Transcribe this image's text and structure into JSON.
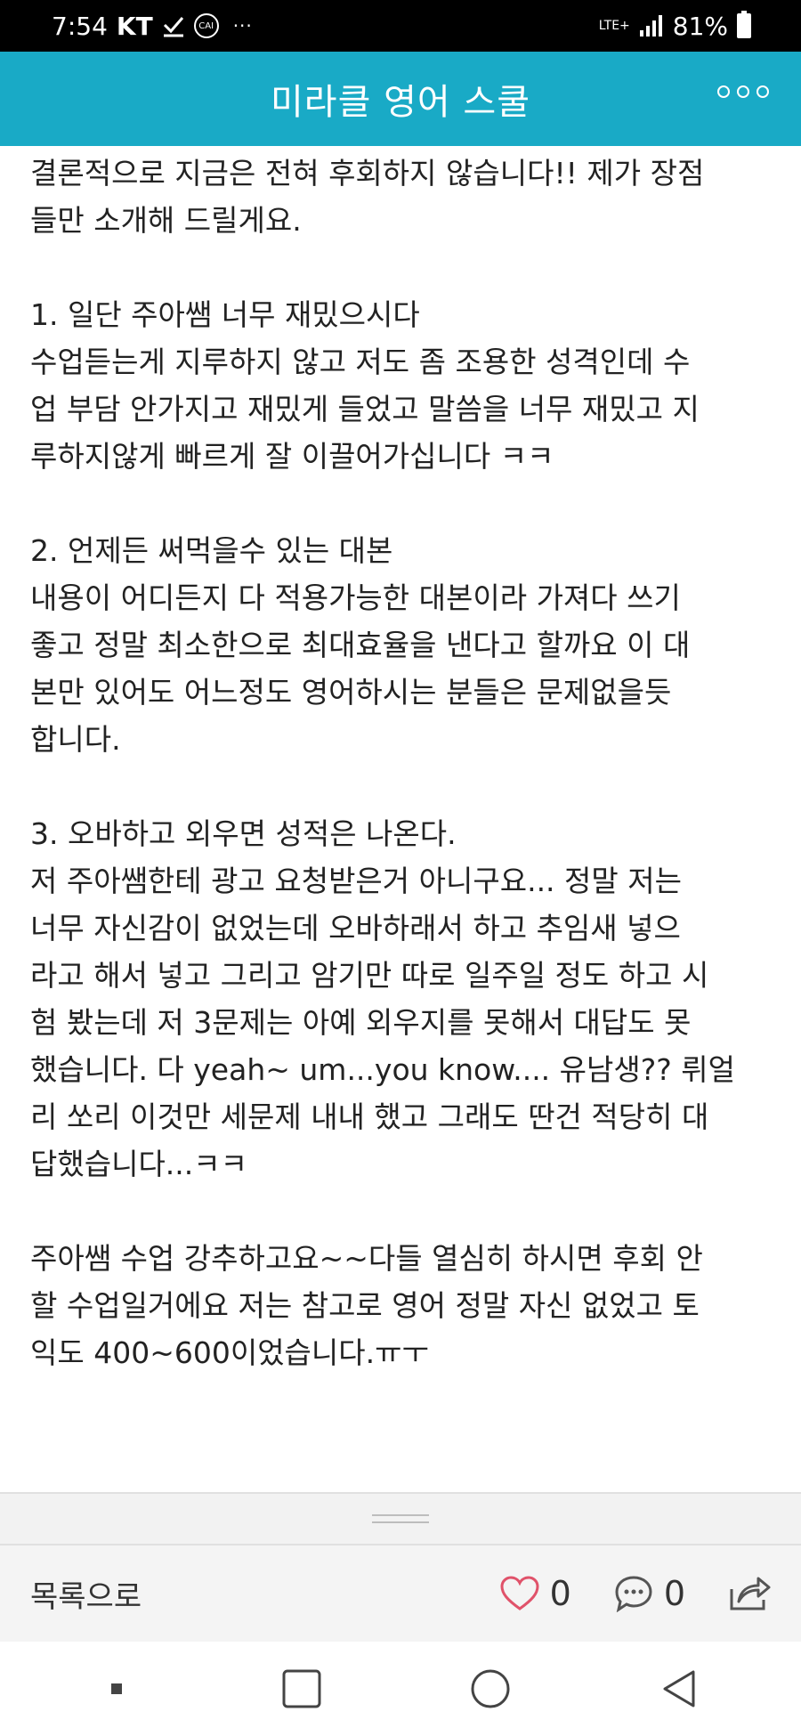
{
  "status_bar": {
    "time": "7:54",
    "carrier": "KT",
    "cai_label": "CAI",
    "more": "···",
    "network": "LTE+",
    "battery": "81%"
  },
  "app_bar": {
    "title": "미라클 영어 스쿨"
  },
  "post": {
    "paragraphs": [
      {
        "lines": [
          "결론적으로 지금은 전혀 후회하지 않습니다!! 제가 장점",
          "들만 소개해 드릴게요."
        ]
      },
      {
        "lines": [
          "1. 일단 주아쌤 너무 재밌으시다",
          "수업듣는게 지루하지 않고 저도 좀 조용한 성격인데 수",
          "업 부담 안가지고 재밌게 들었고 말씀을 너무 재밌고 지",
          "루하지않게 빠르게 잘 이끌어가십니다 ㅋㅋ"
        ]
      },
      {
        "lines": [
          "2. 언제든 써먹을수 있는 대본",
          "내용이 어디든지 다 적용가능한 대본이라 가져다 쓰기",
          "좋고 정말 최소한으로 최대효율을 낸다고 할까요 이 대",
          "본만 있어도 어느정도 영어하시는 분들은 문제없을듯",
          "합니다."
        ]
      },
      {
        "lines": [
          "3. 오바하고 외우면 성적은 나온다.",
          "저 주아쌤한테 광고 요청받은거 아니구요... 정말 저는",
          "너무 자신감이 없었는데 오바하래서 하고 추임새 넣으",
          "라고 해서 넣고 그리고 암기만 따로 일주일 정도 하고 시",
          "험 봤는데 저 3문제는 아예 외우지를 못해서 대답도 못",
          "했습니다. 다 yeah~ um...you know.... 유남생?? 뤼얼",
          "리 쏘리 이것만 세문제 내내 했고 그래도 딴건 적당히 대",
          "답했습니다...ㅋㅋ"
        ]
      },
      {
        "lines": [
          "주아쌤 수업 강추하고요~~다들 열심히 하시면 후회 안",
          "할 수업일거에요 저는 참고로 영어 정말 자신 없었고 토",
          "익도 400~600이었습니다.ㅠㅜ"
        ]
      }
    ]
  },
  "bottom_bar": {
    "back_label": "목록으로",
    "like_count": "0",
    "comment_count": "0"
  },
  "colors": {
    "app_bar": "#19aac6",
    "like_icon": "#e0526a"
  }
}
